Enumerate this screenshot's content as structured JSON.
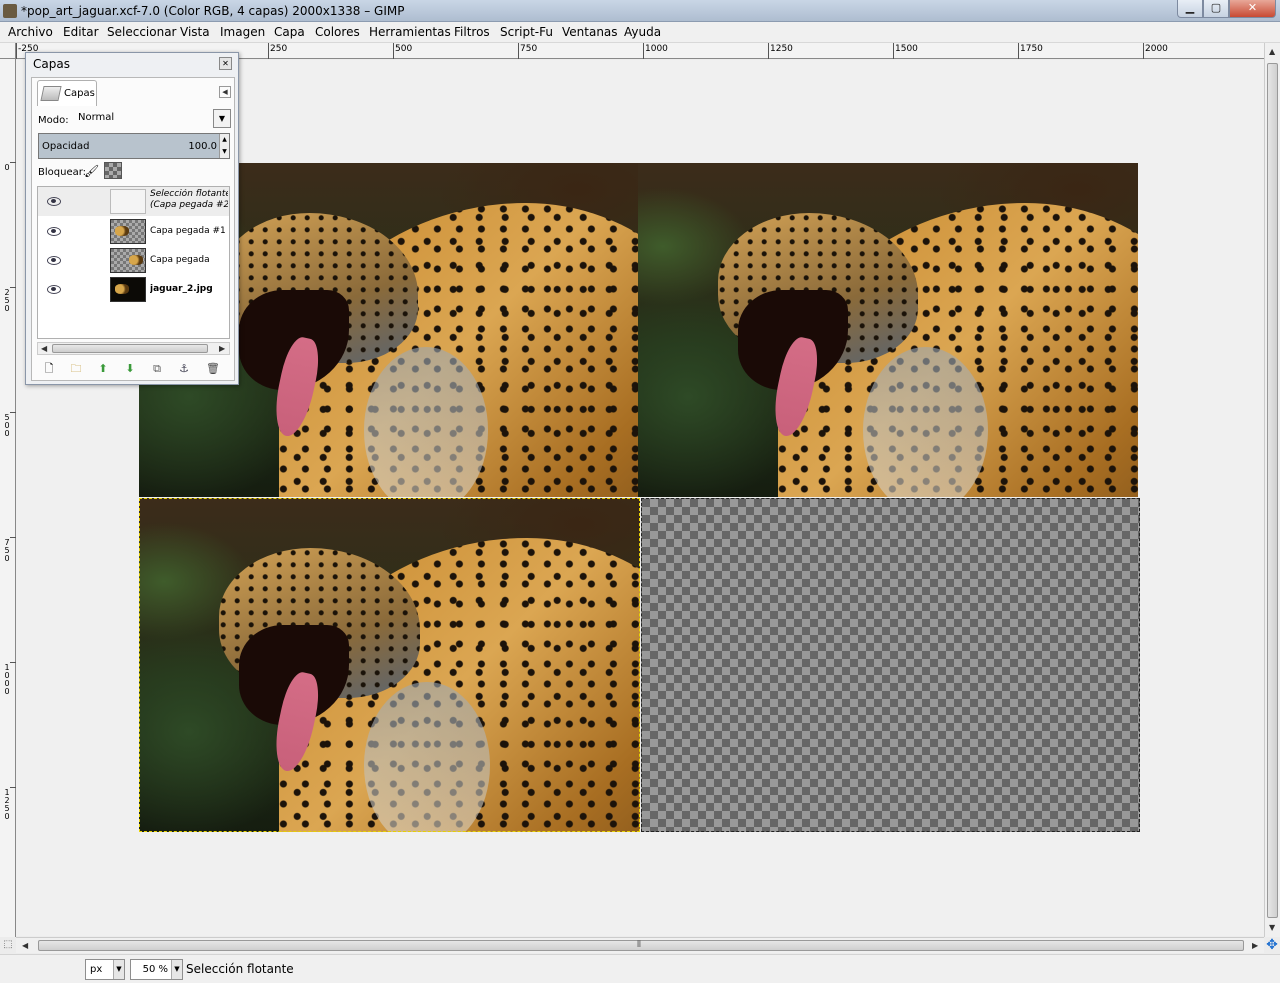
{
  "window": {
    "title": "*pop_art_jaguar.xcf-7.0 (Color RGB, 4 capas) 2000x1338 – GIMP",
    "minimize": "▁",
    "maximize": "▢",
    "close": "✕"
  },
  "menu": [
    "Archivo",
    "Editar",
    "Seleccionar",
    "Vista",
    "Imagen",
    "Capa",
    "Colores",
    "Herramientas",
    "Filtros",
    "Script-Fu",
    "Ventanas",
    "Ayuda"
  ],
  "hruler_labels": [
    "-250",
    "250",
    "500",
    "750",
    "1000",
    "1250",
    "1500",
    "1750",
    "2000"
  ],
  "vruler_labels": [
    "0",
    "250",
    "500",
    "750",
    "1000",
    "1250"
  ],
  "dock": {
    "title": "Capas",
    "tab_label": "Capas",
    "mode_label": "Modo:",
    "mode_value": "Normal",
    "opacity_label": "Opacidad",
    "opacity_value": "100.0",
    "lock_label": "Bloquear:",
    "layers": [
      {
        "name_line1": "Selección flotante",
        "name_line2": "(Capa pegada #2)",
        "thumb": "floating",
        "visible": true
      },
      {
        "name": "Capa pegada #1",
        "thumb": "pasted",
        "visible": true
      },
      {
        "name": "Capa pegada",
        "thumb": "pasted",
        "visible": true
      },
      {
        "name": "jaguar_2.jpg",
        "thumb": "black",
        "visible": true
      }
    ]
  },
  "status": {
    "unit": "px",
    "zoom": "50 %",
    "text": "Selección flotante"
  },
  "colors": {
    "selection_marquee": "#e8d200",
    "checker_dark": "#666666",
    "checker_light": "#999999"
  }
}
